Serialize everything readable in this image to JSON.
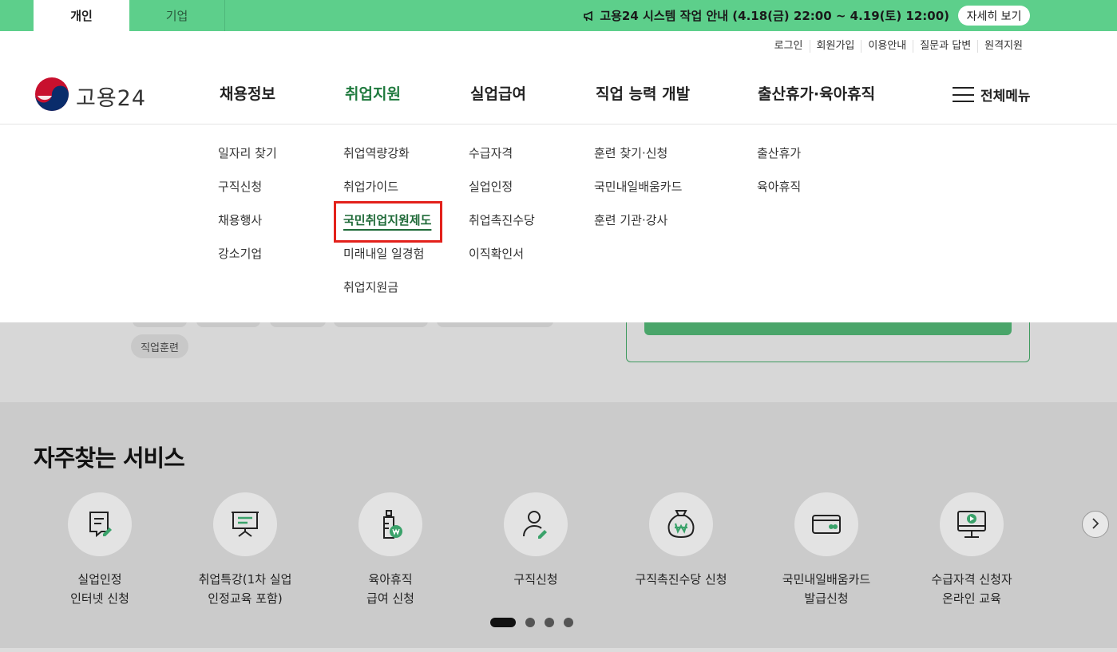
{
  "topbar": {
    "tabs": [
      "개인",
      "기업"
    ],
    "notice": "고용24 시스템 작업 안내 (4.18(금) 22:00 ~ 4.19(토) 12:00)",
    "detail_button": "자세히 보기"
  },
  "util_links": [
    "로그인",
    "회원가입",
    "이용안내",
    "질문과 답변",
    "원격지원"
  ],
  "logo": {
    "text": "고용24"
  },
  "gnb": [
    "채용정보",
    "취업지원",
    "실업급여",
    "직업 능력 개발",
    "출산휴가·육아휴직"
  ],
  "all_menu": "전체메뉴",
  "dropdown": {
    "col1": [
      "일자리 찾기",
      "구직신청",
      "채용행사",
      "강소기업"
    ],
    "col2": [
      "취업역량강화",
      "취업가이드",
      "국민취업지원제도",
      "미래내일 일경험",
      "취업지원금"
    ],
    "col3": [
      "수급자격",
      "실업인정",
      "취업촉진수당",
      "이직확인서"
    ],
    "col4": [
      "훈련 찾기·신청",
      "국민내일배움카드",
      "훈련 기관·강사"
    ],
    "col5": [
      "출산휴가",
      "육아휴직"
    ]
  },
  "chips": [
    "직업훈련"
  ],
  "services": {
    "title": "자주찾는 서비스",
    "items": [
      {
        "label": "실업인정\n인터넷 신청",
        "icon": "document-pen-icon"
      },
      {
        "label": "취업특강(1차 실업\n인정교육 포함)",
        "icon": "presentation-board-icon"
      },
      {
        "label": "육아휴직\n급여 신청",
        "icon": "baby-bottle-won-icon"
      },
      {
        "label": "구직신청",
        "icon": "person-pen-icon"
      },
      {
        "label": "구직촉진수당 신청",
        "icon": "money-bag-won-icon"
      },
      {
        "label": "국민내일배움카드\n발급신청",
        "icon": "card-icon"
      },
      {
        "label": "수급자격 신청자\n온라인 교육",
        "icon": "monitor-play-icon"
      }
    ]
  },
  "colors": {
    "green": "#5dcf8b",
    "active_text": "#1f7a3e",
    "highlight": "#e3211b"
  }
}
